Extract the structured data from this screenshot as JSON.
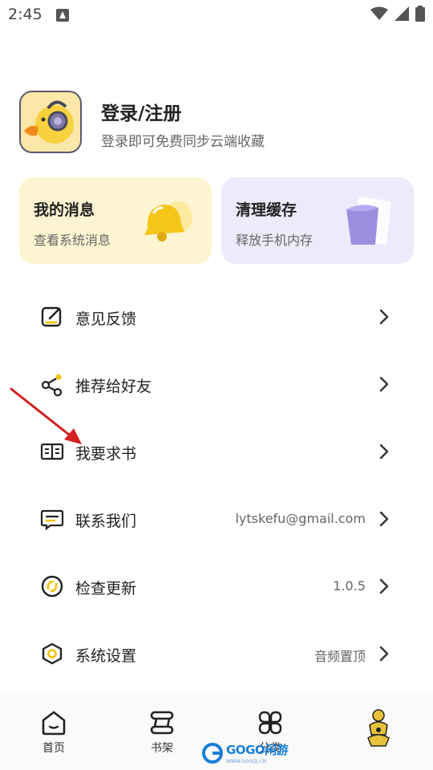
{
  "status_bar": {
    "time": "2:45"
  },
  "profile": {
    "title": "登录/注册",
    "subtitle": "登录即可免费同步云端收藏"
  },
  "cards": {
    "messages": {
      "title": "我的消息",
      "subtitle": "查看系统消息"
    },
    "cache": {
      "title": "清理缓存",
      "subtitle": "释放手机内存"
    }
  },
  "menu": {
    "feedback": {
      "label": "意见反馈",
      "value": ""
    },
    "share": {
      "label": "推荐给好友",
      "value": ""
    },
    "request_book": {
      "label": "我要求书",
      "value": ""
    },
    "contact": {
      "label": "联系我们",
      "value": "lytskefu@gmail.com"
    },
    "update": {
      "label": "检查更新",
      "value": "1.0.5"
    },
    "settings": {
      "label": "系统设置",
      "value": "音频置顶"
    }
  },
  "bottom_nav": {
    "home": "首页",
    "shelf": "书架",
    "category": "分类",
    "mine": ""
  },
  "watermark": {
    "text": "GOGO闲游",
    "url": "WWW.GOGOJ.CN"
  },
  "colors": {
    "messages_card_bg": "#fdf4d2",
    "cache_card_bg": "#ecebfb",
    "accent_yellow": "#f5c518",
    "accent_purple": "#9d8ee0",
    "annotation_arrow": "#d42020"
  }
}
